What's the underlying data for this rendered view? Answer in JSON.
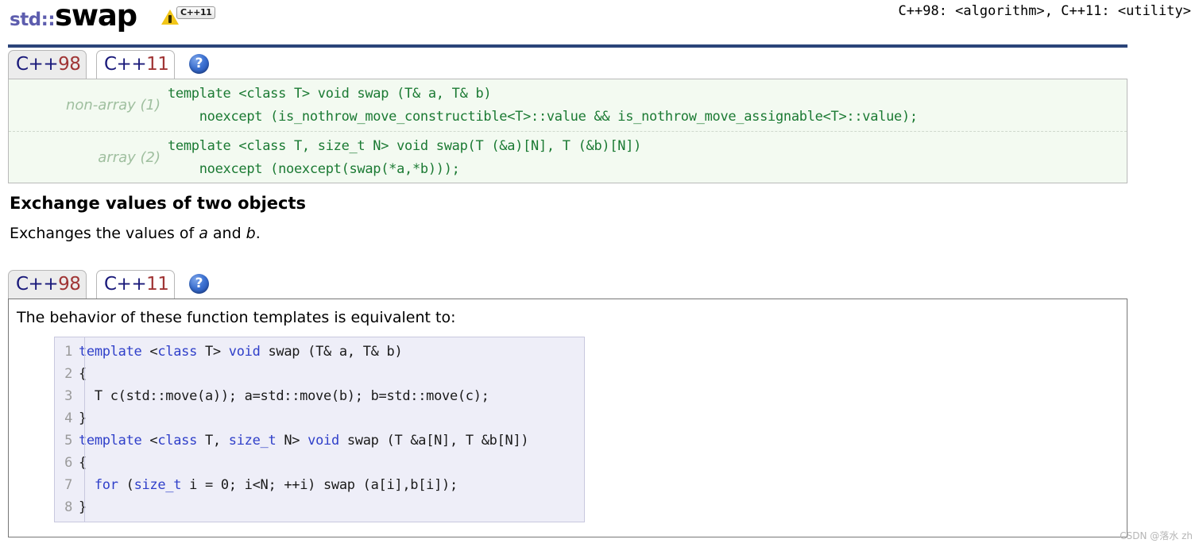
{
  "header": {
    "namespace": "std::",
    "function": "swap",
    "badge": {
      "warning_icon": "warning-triangle-icon",
      "chip_label": "C++11"
    },
    "headers_note": "C++98: <algorithm>, C++11: <utility>"
  },
  "signature_tabs": {
    "items": [
      {
        "label_prefix": "C++",
        "label_suffix": "98",
        "active": false
      },
      {
        "label_prefix": "C++",
        "label_suffix": "11",
        "active": true
      }
    ],
    "help_icon_label": "?"
  },
  "signature": {
    "rows": [
      {
        "label": "non-array (1)",
        "code": "template <class T> void swap (T& a, T& b)\n    noexcept (is_nothrow_move_constructible<T>::value && is_nothrow_move_assignable<T>::value);"
      },
      {
        "label": "array (2)",
        "code": "template <class T, size_t N> void swap(T (&a)[N], T (&b)[N])\n    noexcept (noexcept(swap(*a,*b)));"
      }
    ]
  },
  "description": {
    "title": "Exchange values of two objects",
    "body_prefix": "Exchanges the values of ",
    "body_var_a": "a",
    "body_middle": " and ",
    "body_var_b": "b",
    "body_suffix": "."
  },
  "behavior_tabs": {
    "items": [
      {
        "label_prefix": "C++",
        "label_suffix": "98",
        "active": false
      },
      {
        "label_prefix": "C++",
        "label_suffix": "11",
        "active": true
      }
    ],
    "help_icon_label": "?"
  },
  "behavior": {
    "intro": "The behavior of these function templates is equivalent to:",
    "code_lines": [
      {
        "n": "1",
        "parts": [
          {
            "t": "template ",
            "k": true
          },
          {
            "t": "<",
            "k": false
          },
          {
            "t": "class",
            "k": true
          },
          {
            "t": " T",
            "k": false
          },
          {
            "t": ">",
            "k": false
          },
          {
            "t": " ",
            "k": false
          },
          {
            "t": "void",
            "k": true
          },
          {
            "t": " swap (T& a, T& b)",
            "k": false
          }
        ]
      },
      {
        "n": "2",
        "parts": [
          {
            "t": "{",
            "k": false
          }
        ]
      },
      {
        "n": "3",
        "parts": [
          {
            "t": "  T c(std::move(a)); a=std::move(b); b=std::move(c);",
            "k": false
          }
        ]
      },
      {
        "n": "4",
        "parts": [
          {
            "t": "}",
            "k": false
          }
        ]
      },
      {
        "n": "5",
        "parts": [
          {
            "t": "template ",
            "k": true
          },
          {
            "t": "<",
            "k": false
          },
          {
            "t": "class",
            "k": true
          },
          {
            "t": " T, ",
            "k": false
          },
          {
            "t": "size_t",
            "k": true
          },
          {
            "t": " N",
            "k": false
          },
          {
            "t": ">",
            "k": false
          },
          {
            "t": " ",
            "k": false
          },
          {
            "t": "void",
            "k": true
          },
          {
            "t": " swap (T &a[N], T &b[N])",
            "k": false
          }
        ]
      },
      {
        "n": "6",
        "parts": [
          {
            "t": "{",
            "k": false
          }
        ]
      },
      {
        "n": "7",
        "parts": [
          {
            "t": "  ",
            "k": false
          },
          {
            "t": "for",
            "k": true
          },
          {
            "t": " (",
            "k": false
          },
          {
            "t": "size_t",
            "k": true
          },
          {
            "t": " i = 0; i<N; ++i) swap (a[i],b[i]);",
            "k": false
          }
        ]
      },
      {
        "n": "8",
        "parts": [
          {
            "t": "}",
            "k": false
          }
        ]
      }
    ]
  },
  "watermark": "CSDN @落水 zh",
  "colors": {
    "accent_rule": "#2b4479",
    "tab_text": "#19197a",
    "tab_suffix_red": "#a03535",
    "signature_code": "#1b7a33",
    "signature_bg": "#f3faf1",
    "signature_label": "#9fbf9f",
    "code_bg": "#eeeef8",
    "code_keyword": "#2f3fc9",
    "namespace_purple": "#5d5dae"
  }
}
